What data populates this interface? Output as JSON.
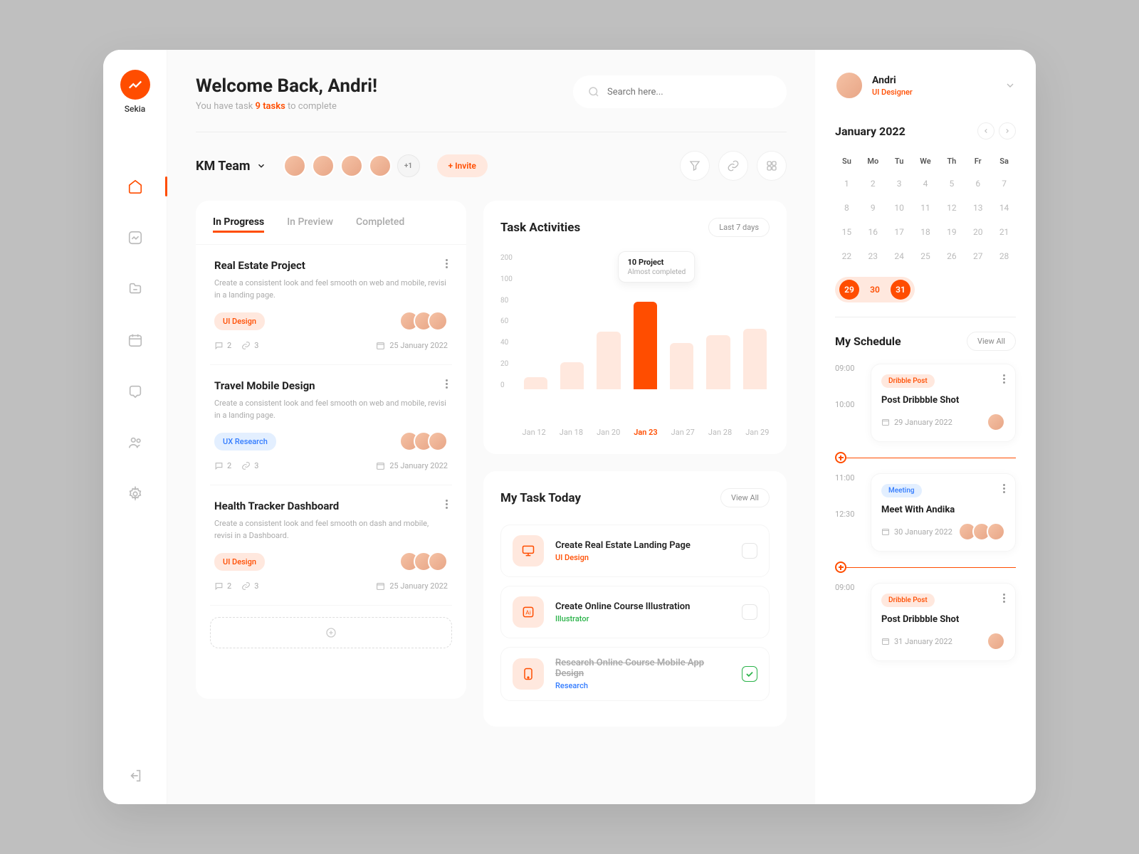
{
  "brand": "Sekia",
  "welcome": {
    "title": "Welcome Back, Andri!",
    "subtitle_pre": "You have task ",
    "subtitle_hl": "9 tasks",
    "subtitle_post": " to complete"
  },
  "search": {
    "placeholder": "Search here..."
  },
  "team": {
    "name": "KM Team",
    "more": "+1",
    "invite": "+ Invite"
  },
  "tabs": {
    "progress": "In Progress",
    "preview": "In Preview",
    "completed": "Completed"
  },
  "tasks": [
    {
      "title": "Real Estate Project",
      "desc": "Create a consistent look and feel smooth on web and mobile, revisi in a landing page.",
      "tag": "UI Design",
      "tag_type": "ui",
      "comments": "2",
      "links": "3",
      "date": "25 January 2022"
    },
    {
      "title": "Travel Mobile Design",
      "desc": "Create a consistent look and feel smooth on web and mobile, revisi in a landing page.",
      "tag": "UX Research",
      "tag_type": "ux",
      "comments": "2",
      "links": "3",
      "date": "25 January 2022"
    },
    {
      "title": "Health Tracker Dashboard",
      "desc": "Create a consistent look and feel smooth on dash and mobile, revisi in a Dashboard.",
      "tag": "UI Design",
      "tag_type": "ui",
      "comments": "2",
      "links": "3",
      "date": "25 January 2022"
    }
  ],
  "chart": {
    "title": "Task Activities",
    "range": "Last 7 days",
    "tooltip_title": "10 Project",
    "tooltip_sub": "Almost completed"
  },
  "chart_data": {
    "type": "bar",
    "categories": [
      "Jan 12",
      "Jan 18",
      "Jan 20",
      "Jan 23",
      "Jan 27",
      "Jan 28",
      "Jan 29"
    ],
    "values": [
      18,
      40,
      85,
      130,
      68,
      80,
      90
    ],
    "ylabel": "",
    "xlabel": "",
    "ylim": [
      0,
      200
    ],
    "yticks": [
      0,
      20,
      40,
      60,
      80,
      100,
      200
    ],
    "highlighted_index": 3
  },
  "today": {
    "title": "My Task Today",
    "view_all": "View All",
    "items": [
      {
        "title": "Create Real Estate Landing Page",
        "tag": "UI Design",
        "tag_type": "ui",
        "done": false
      },
      {
        "title": "Create Online Course Illustration",
        "tag": "Illustrator",
        "tag_type": "ill",
        "done": false
      },
      {
        "title": "Research Online Course Mobile App Design",
        "tag": "Research",
        "tag_type": "res",
        "done": true
      }
    ]
  },
  "user": {
    "name": "Andri",
    "role": "UI Designer"
  },
  "calendar": {
    "title": "January 2022",
    "days_head": [
      "Su",
      "Mo",
      "Tu",
      "We",
      "Th",
      "Fr",
      "Sa"
    ],
    "weeks": [
      [
        "1",
        "2",
        "3",
        "4",
        "5",
        "6",
        "7"
      ],
      [
        "8",
        "9",
        "10",
        "11",
        "12",
        "13",
        "14"
      ],
      [
        "15",
        "16",
        "17",
        "18",
        "19",
        "20",
        "21"
      ],
      [
        "22",
        "23",
        "24",
        "25",
        "26",
        "27",
        "28"
      ]
    ],
    "hl_row": [
      "29",
      "30",
      "31"
    ]
  },
  "schedule": {
    "title": "My Schedule",
    "view_all": "View All",
    "items": [
      {
        "t1": "09:00",
        "t2": "10:00",
        "tag": "Dribble Post",
        "tag_type": "dribble",
        "title": "Post Dribbble Shot",
        "date": "29 January 2022",
        "avatars": 1
      },
      {
        "t1": "11:00",
        "t2": "12:30",
        "tag": "Meeting",
        "tag_type": "meeting",
        "title": "Meet With Andika",
        "date": "30 January 2022",
        "avatars": 3
      },
      {
        "t1": "09:00",
        "t2": "",
        "tag": "Dribble Post",
        "tag_type": "dribble",
        "title": "Post Dribbble Shot",
        "date": "31 January 2022",
        "avatars": 1
      }
    ]
  }
}
